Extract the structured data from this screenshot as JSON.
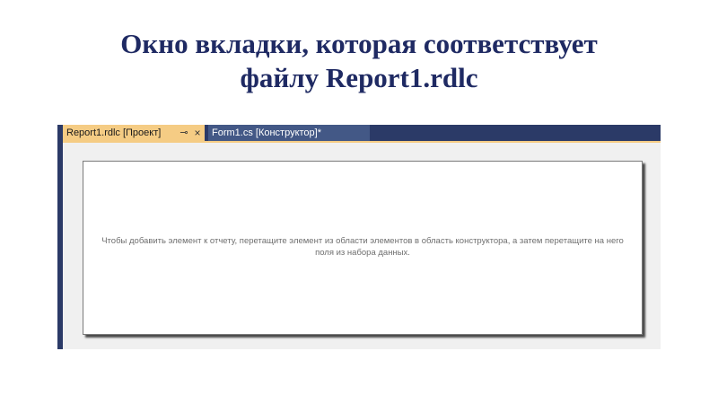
{
  "slide": {
    "title_line1": "Окно вкладки, которая соответствует",
    "title_line2": "файлу Report1.rdlc"
  },
  "tabs": [
    {
      "label": "Report1.rdlc [Проект]",
      "pin_glyph": "⊸",
      "close_glyph": "×",
      "active": true
    },
    {
      "label": "Form1.cs [Конструктор]*",
      "active": false
    }
  ],
  "designer": {
    "hint": "Чтобы добавить элемент к отчету, перетащите элемент из области элементов в область конструктора, а затем перетащите на него поля из набора данных."
  },
  "colors": {
    "title": "#1f2a63",
    "tab_strip": "#2b3a67",
    "active_tab": "#f5cc84",
    "inactive_tab": "#435886"
  }
}
